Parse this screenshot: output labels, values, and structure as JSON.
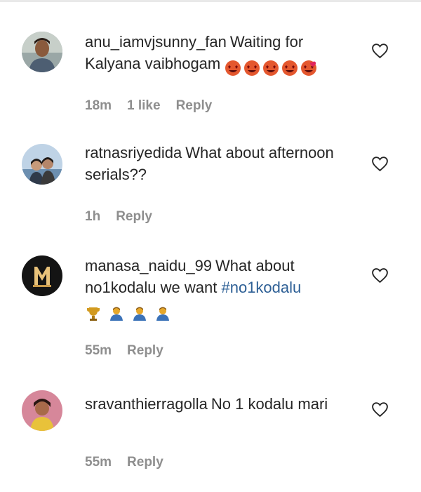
{
  "comments": [
    {
      "username": "anu_iamvjsunny_fan",
      "text": "Waiting for Kalyana vaibhogam",
      "emoji": [
        "heart-eyes-emoji",
        "heart-eyes-emoji",
        "heart-eyes-emoji",
        "heart-eyes-emoji",
        "heart-eyes-emoji"
      ],
      "time": "18m",
      "likes": "1 like",
      "reply": "Reply"
    },
    {
      "username": "ratnasriyedida",
      "text": "What about afternoon serials??",
      "time": "1h",
      "reply": "Reply"
    },
    {
      "username": "manasa_naidu_99",
      "text": "What about no1kodalu we want",
      "hashtag": "#no1kodalu",
      "emoji": [
        "trophy-emoji",
        "person-emoji",
        "person-emoji",
        "person-emoji"
      ],
      "time": "55m",
      "reply": "Reply"
    },
    {
      "username": "sravanthierragolla",
      "text": "No 1 kodalu mari",
      "time": "55m",
      "reply": "Reply"
    }
  ],
  "colors": {
    "text": "#262626",
    "meta": "#8e8e8e",
    "hashtag": "#2d5f95",
    "emoji_face": "#e4572e",
    "heart_red": "#e0245e"
  },
  "icons": {
    "like": "heart-outline-icon"
  }
}
